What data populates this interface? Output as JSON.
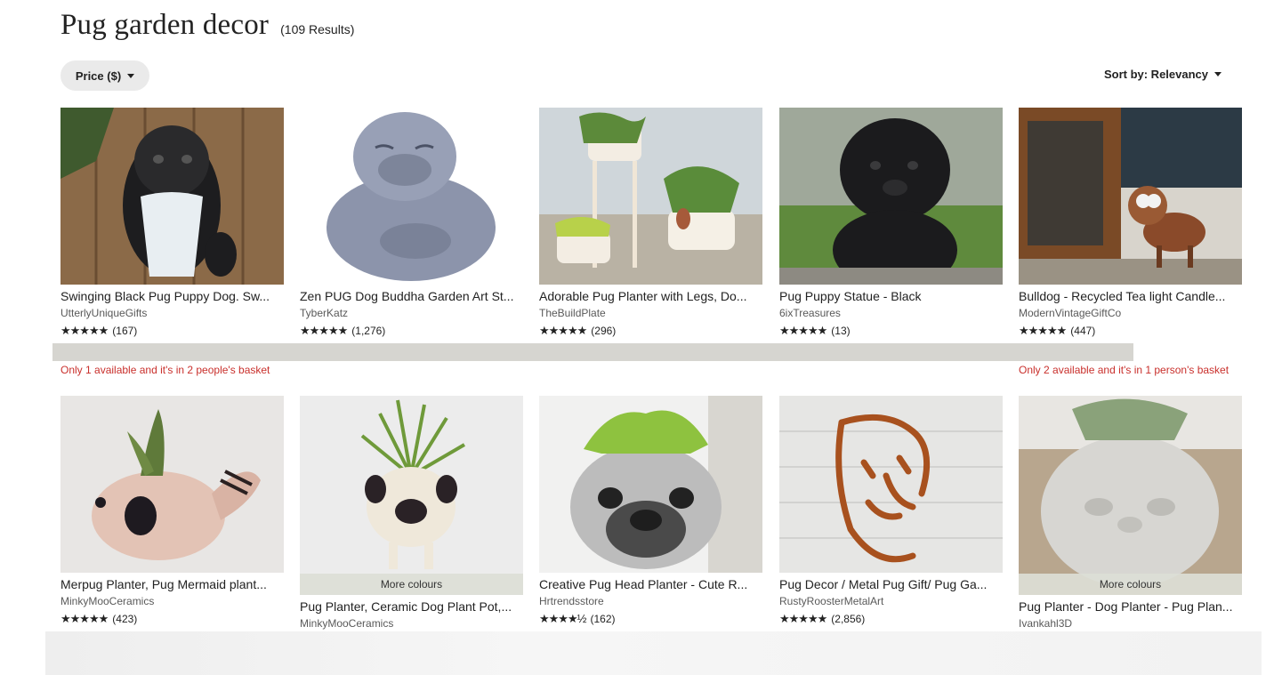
{
  "header": {
    "title": "Pug garden decor",
    "count": "(109 Results)"
  },
  "filters": {
    "price_label": "Price ($)"
  },
  "sort": {
    "label": "Sort by: Relevancy"
  },
  "notices": [
    "Only 1 available and it's in 2 people's basket",
    "Only 2 available and it's in 1 person's basket"
  ],
  "listings": [
    {
      "title": "Swinging Black Pug Puppy Dog. Sw...",
      "shop": "UtterlyUniqueGifts",
      "stars": "★★★★★",
      "reviews": "(167)"
    },
    {
      "title": "Zen PUG Dog Buddha Garden Art St...",
      "shop": "TyberKatz",
      "stars": "★★★★★",
      "reviews": "(1,276)"
    },
    {
      "title": "Adorable Pug Planter with Legs, Do...",
      "shop": "TheBuildPlate",
      "stars": "★★★★★",
      "reviews": "(296)"
    },
    {
      "title": "Pug Puppy Statue - Black",
      "shop": "6ixTreasures",
      "stars": "★★★★★",
      "reviews": "(13)"
    },
    {
      "title": "Bulldog - Recycled Tea light Candle...",
      "shop": "ModernVintageGiftCo",
      "stars": "★★★★★",
      "reviews": "(447)"
    },
    {
      "title": "Merpug Planter, Pug Mermaid plant...",
      "shop": "MinkyMooCeramics",
      "stars": "★★★★★",
      "reviews": "(423)"
    },
    {
      "title": "Pug Planter, Ceramic Dog Plant Pot,...",
      "shop": "MinkyMooCeramics",
      "more": "More colours"
    },
    {
      "title": "Creative Pug Head Planter - Cute R...",
      "shop": "Hrtrendsstore",
      "stars": "★★★★½",
      "reviews": "(162)"
    },
    {
      "title": "Pug Decor / Metal Pug Gift/ Pug Ga...",
      "shop": "RustyRoosterMetalArt",
      "stars": "★★★★★",
      "reviews": "(2,856)"
    },
    {
      "title": "Pug Planter - Dog Planter - Pug Plan...",
      "shop": "Ivankahl3D",
      "more": "More colours"
    }
  ]
}
